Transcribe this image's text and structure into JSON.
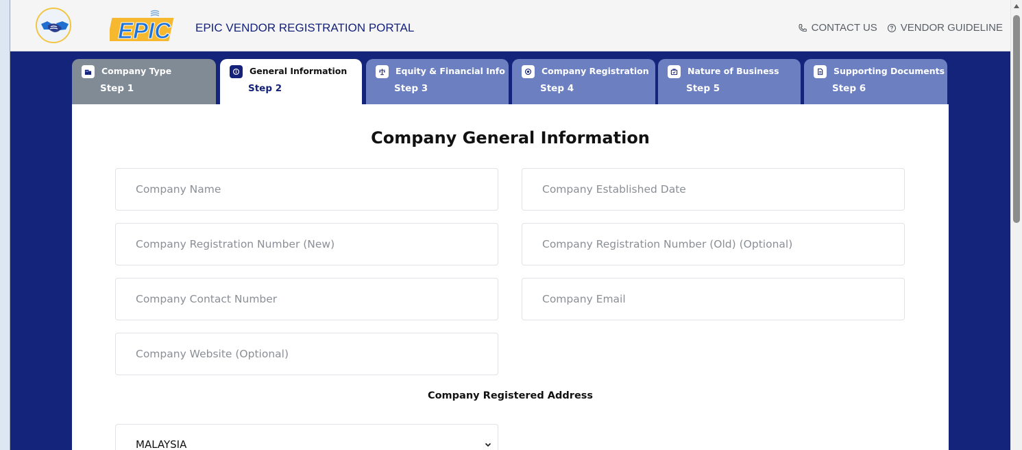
{
  "header": {
    "portal_title": "EPIC VENDOR REGISTRATION PORTAL",
    "logo_text": "EPIC",
    "contact_us": "CONTACT US",
    "vendor_guideline": "VENDOR GUIDELINE"
  },
  "tabs": [
    {
      "label": "Company Type",
      "step": "Step 1",
      "state": "done",
      "icon": "building-icon"
    },
    {
      "label": "General Information",
      "step": "Step 2",
      "state": "active",
      "icon": "info-icon"
    },
    {
      "label": "Equity & Financial Info",
      "step": "Step 3",
      "state": "todo",
      "icon": "scale-icon"
    },
    {
      "label": "Company Registration",
      "step": "Step 4",
      "state": "todo",
      "icon": "badge-icon"
    },
    {
      "label": "Nature of Business",
      "step": "Step 5",
      "state": "todo",
      "icon": "briefcase-icon"
    },
    {
      "label": "Supporting Documents",
      "step": "Step 6",
      "state": "todo",
      "icon": "document-icon"
    }
  ],
  "form": {
    "title": "Company General Information",
    "fields": {
      "company_name": {
        "placeholder": "Company Name",
        "value": ""
      },
      "established_date": {
        "placeholder": "Company Established Date",
        "value": ""
      },
      "reg_number_new": {
        "placeholder": "Company Registration Number (New)",
        "value": ""
      },
      "reg_number_old": {
        "placeholder": "Company Registration Number (Old) (Optional)",
        "value": ""
      },
      "contact_number": {
        "placeholder": "Company Contact Number",
        "value": ""
      },
      "email": {
        "placeholder": "Company Email",
        "value": ""
      },
      "website": {
        "placeholder": "Company Website (Optional)",
        "value": ""
      }
    },
    "address_section": "Company Registered Address",
    "country": {
      "selected": "MALAYSIA"
    }
  },
  "colors": {
    "brand_navy": "#13247a",
    "tab_done": "#818b96",
    "tab_todo": "#6c7fc0",
    "logo_yellow": "#f5b82e",
    "logo_blue": "#1e73d9"
  }
}
